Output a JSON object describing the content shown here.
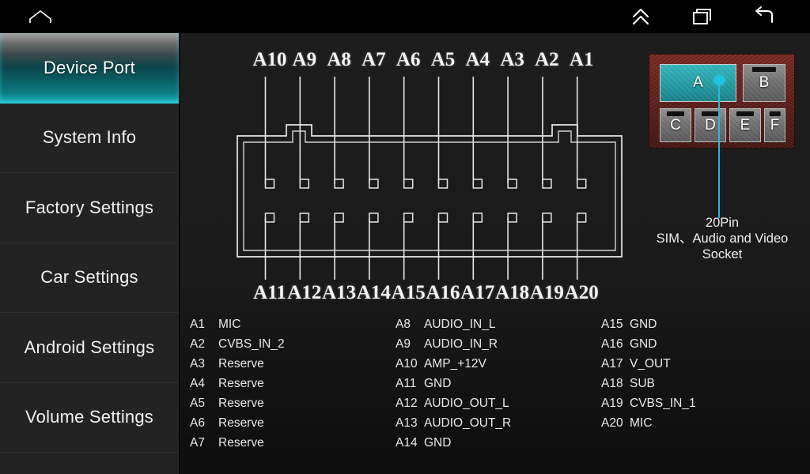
{
  "navbar": {
    "icons": [
      {
        "name": "home-icon",
        "label": "Home"
      },
      {
        "name": "chevron-up-double-icon",
        "label": "Expand"
      },
      {
        "name": "recent-apps-icon",
        "label": "Recent apps"
      },
      {
        "name": "back-icon",
        "label": "Back"
      }
    ]
  },
  "sidebar": {
    "items": [
      {
        "label": "Device Port",
        "selected": true
      },
      {
        "label": "System Info",
        "selected": false
      },
      {
        "label": "Factory Settings",
        "selected": false
      },
      {
        "label": "Car Settings",
        "selected": false
      },
      {
        "label": "Android Settings",
        "selected": false
      },
      {
        "label": "Volume Settings",
        "selected": false
      },
      {
        "label": "",
        "selected": false
      }
    ]
  },
  "connector": {
    "top_labels": [
      "A10",
      "A9",
      "A8",
      "A7",
      "A6",
      "A5",
      "A4",
      "A3",
      "A2",
      "A1"
    ],
    "bottom_labels": [
      "A11",
      "A12",
      "A13",
      "A14",
      "A15",
      "A16",
      "A17",
      "A18",
      "A19",
      "A20"
    ]
  },
  "socket": {
    "slots": [
      {
        "label": "A",
        "active": true
      },
      {
        "label": "B",
        "active": false
      },
      {
        "label": "C",
        "active": false
      },
      {
        "label": "D",
        "active": false
      },
      {
        "label": "E",
        "active": false
      },
      {
        "label": "F",
        "active": false
      }
    ],
    "caption_line1": "20Pin",
    "caption_line2": "SIM、Audio and Video",
    "caption_line3": "Socket",
    "highlight_color": "#22c3e2",
    "panel_color": "#5e211c"
  },
  "pin_columns": [
    [
      {
        "id": "A1",
        "desc": "MIC"
      },
      {
        "id": "A2",
        "desc": "CVBS_IN_2"
      },
      {
        "id": "A3",
        "desc": "Reserve"
      },
      {
        "id": "A4",
        "desc": "Reserve"
      },
      {
        "id": "A5",
        "desc": "Reserve"
      },
      {
        "id": "A6",
        "desc": "Reserve"
      },
      {
        "id": "A7",
        "desc": "Reserve"
      }
    ],
    [
      {
        "id": "A8",
        "desc": "AUDIO_IN_L"
      },
      {
        "id": "A9",
        "desc": "AUDIO_IN_R"
      },
      {
        "id": "A10",
        "desc": "AMP_+12V"
      },
      {
        "id": "A11",
        "desc": "GND"
      },
      {
        "id": "A12",
        "desc": "AUDIO_OUT_L"
      },
      {
        "id": "A13",
        "desc": "AUDIO_OUT_R"
      },
      {
        "id": "A14",
        "desc": "GND"
      }
    ],
    [
      {
        "id": "A15",
        "desc": "GND"
      },
      {
        "id": "A16",
        "desc": "GND"
      },
      {
        "id": "A17",
        "desc": "V_OUT"
      },
      {
        "id": "A18",
        "desc": "SUB"
      },
      {
        "id": "A19",
        "desc": "CVBS_IN_1"
      },
      {
        "id": "A20",
        "desc": "MIC"
      }
    ]
  ]
}
